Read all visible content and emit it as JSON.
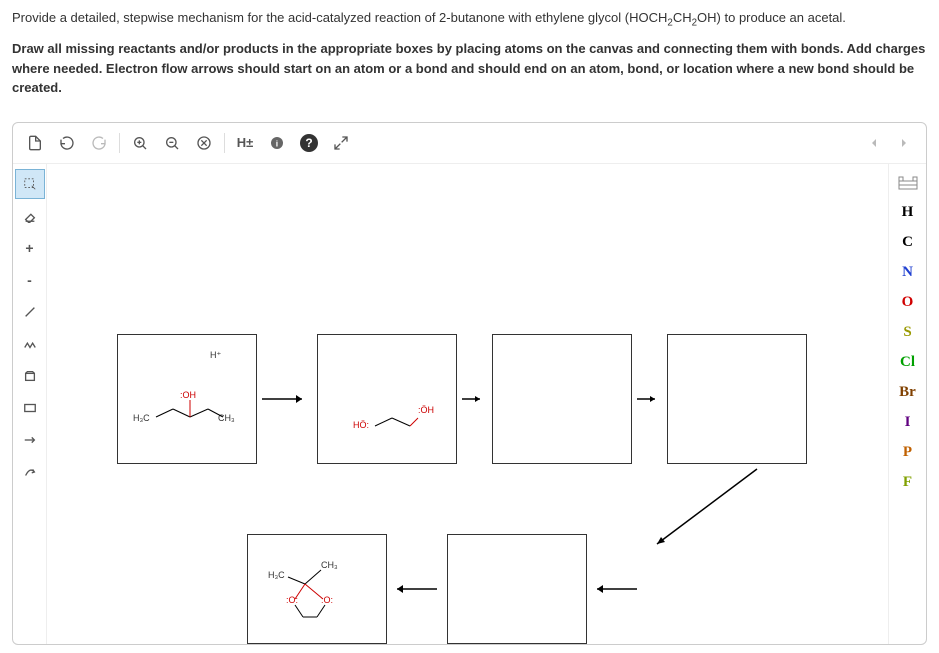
{
  "question": {
    "line1_pre": "Provide a detailed, stepwise mechanism for the acid-catalyzed reaction of 2-butanone with ethylene glycol (HOCH",
    "line1_sub1": "2",
    "line1_mid": "CH",
    "line1_sub2": "2",
    "line1_post": "OH) to produce an acetal.",
    "line2": "Draw all missing reactants and/or products in the appropriate boxes by placing atoms on the canvas and connecting them with bonds. Add charges where needed. Electron flow arrows should start on an atom or a bond and should end on an atom, bond, or location where a new bond should be created."
  },
  "toolbar": {
    "h_label": "H±"
  },
  "elements": {
    "H": "H",
    "C": "C",
    "N": "N",
    "O": "O",
    "S": "S",
    "Cl": "Cl",
    "Br": "Br",
    "I": "I",
    "P": "P",
    "F": "F"
  },
  "left_tools": {
    "plus": "+",
    "minus": "-"
  },
  "chem": {
    "h_plus": "H⁺",
    "oh_red": ":OH",
    "h3c": "H₃C",
    "ch3": "CH₃",
    "ho_red": "HÖ:",
    "oh2_red": ":ÖH",
    "o_red": ":O:"
  }
}
